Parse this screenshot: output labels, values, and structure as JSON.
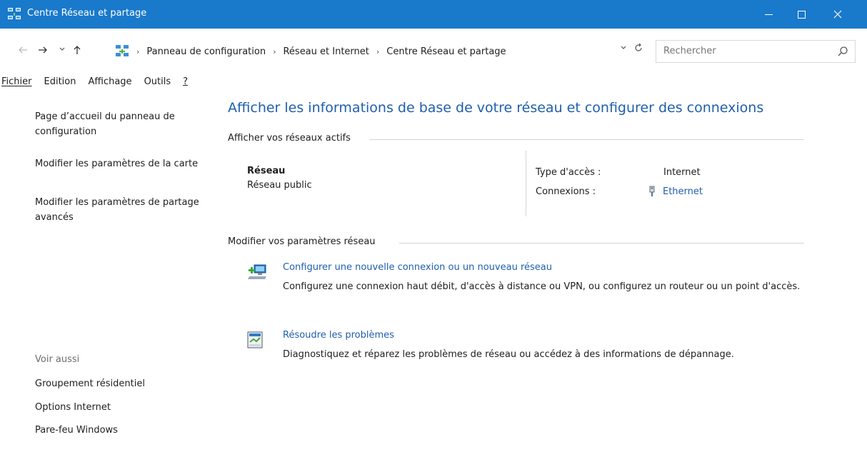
{
  "window": {
    "title": "Centre Réseau et partage",
    "accent": "#1979ca",
    "controls": {
      "minimize": "—",
      "maximize": "☐",
      "close": "✕"
    }
  },
  "navigation": {
    "back_icon": "arrow-left-icon",
    "forward_icon": "arrow-right-icon",
    "recent_icon": "chevron-down-icon",
    "up_icon": "arrow-up-icon",
    "breadcrumbs": [
      "Panneau de configuration",
      "Réseau et Internet",
      "Centre Réseau et partage"
    ],
    "search_placeholder": "Rechercher"
  },
  "menu": {
    "items": [
      "Fichier",
      "Edition",
      "Affichage",
      "Outils",
      "?"
    ]
  },
  "sidebar": {
    "links": [
      "Page d’accueil du panneau de configuration",
      "Modifier les paramètres de la carte",
      "Modifier les paramètres de partage avancés"
    ],
    "see_also_label": "Voir aussi",
    "see_also": [
      "Groupement résidentiel",
      "Options Internet",
      "Pare-feu Windows"
    ]
  },
  "main": {
    "title": "Afficher les informations de base de votre réseau et configurer des connexions",
    "active_networks_heading": "Afficher vos réseaux actifs",
    "network": {
      "name": "Réseau",
      "type": "Réseau public",
      "access_label": "Type d'accès :",
      "access_value": "Internet",
      "connections_label": "Connexions :",
      "connections_value": "Ethernet"
    },
    "change_heading": "Modifier vos paramètres réseau",
    "tasks": [
      {
        "link": "Configurer une nouvelle connexion ou un nouveau réseau",
        "description": "Configurez une connexion haut débit, d'accès à distance ou VPN, ou configurez un routeur ou un point d'accès."
      },
      {
        "link": "Résoudre les problèmes",
        "description": "Diagnostiquez et réparez les problèmes de réseau ou accédez à des informations de dépannage."
      }
    ]
  },
  "colors": {
    "link": "#1f5fad",
    "title_link": "#1f5fad",
    "muted": "#6d6d6d"
  }
}
